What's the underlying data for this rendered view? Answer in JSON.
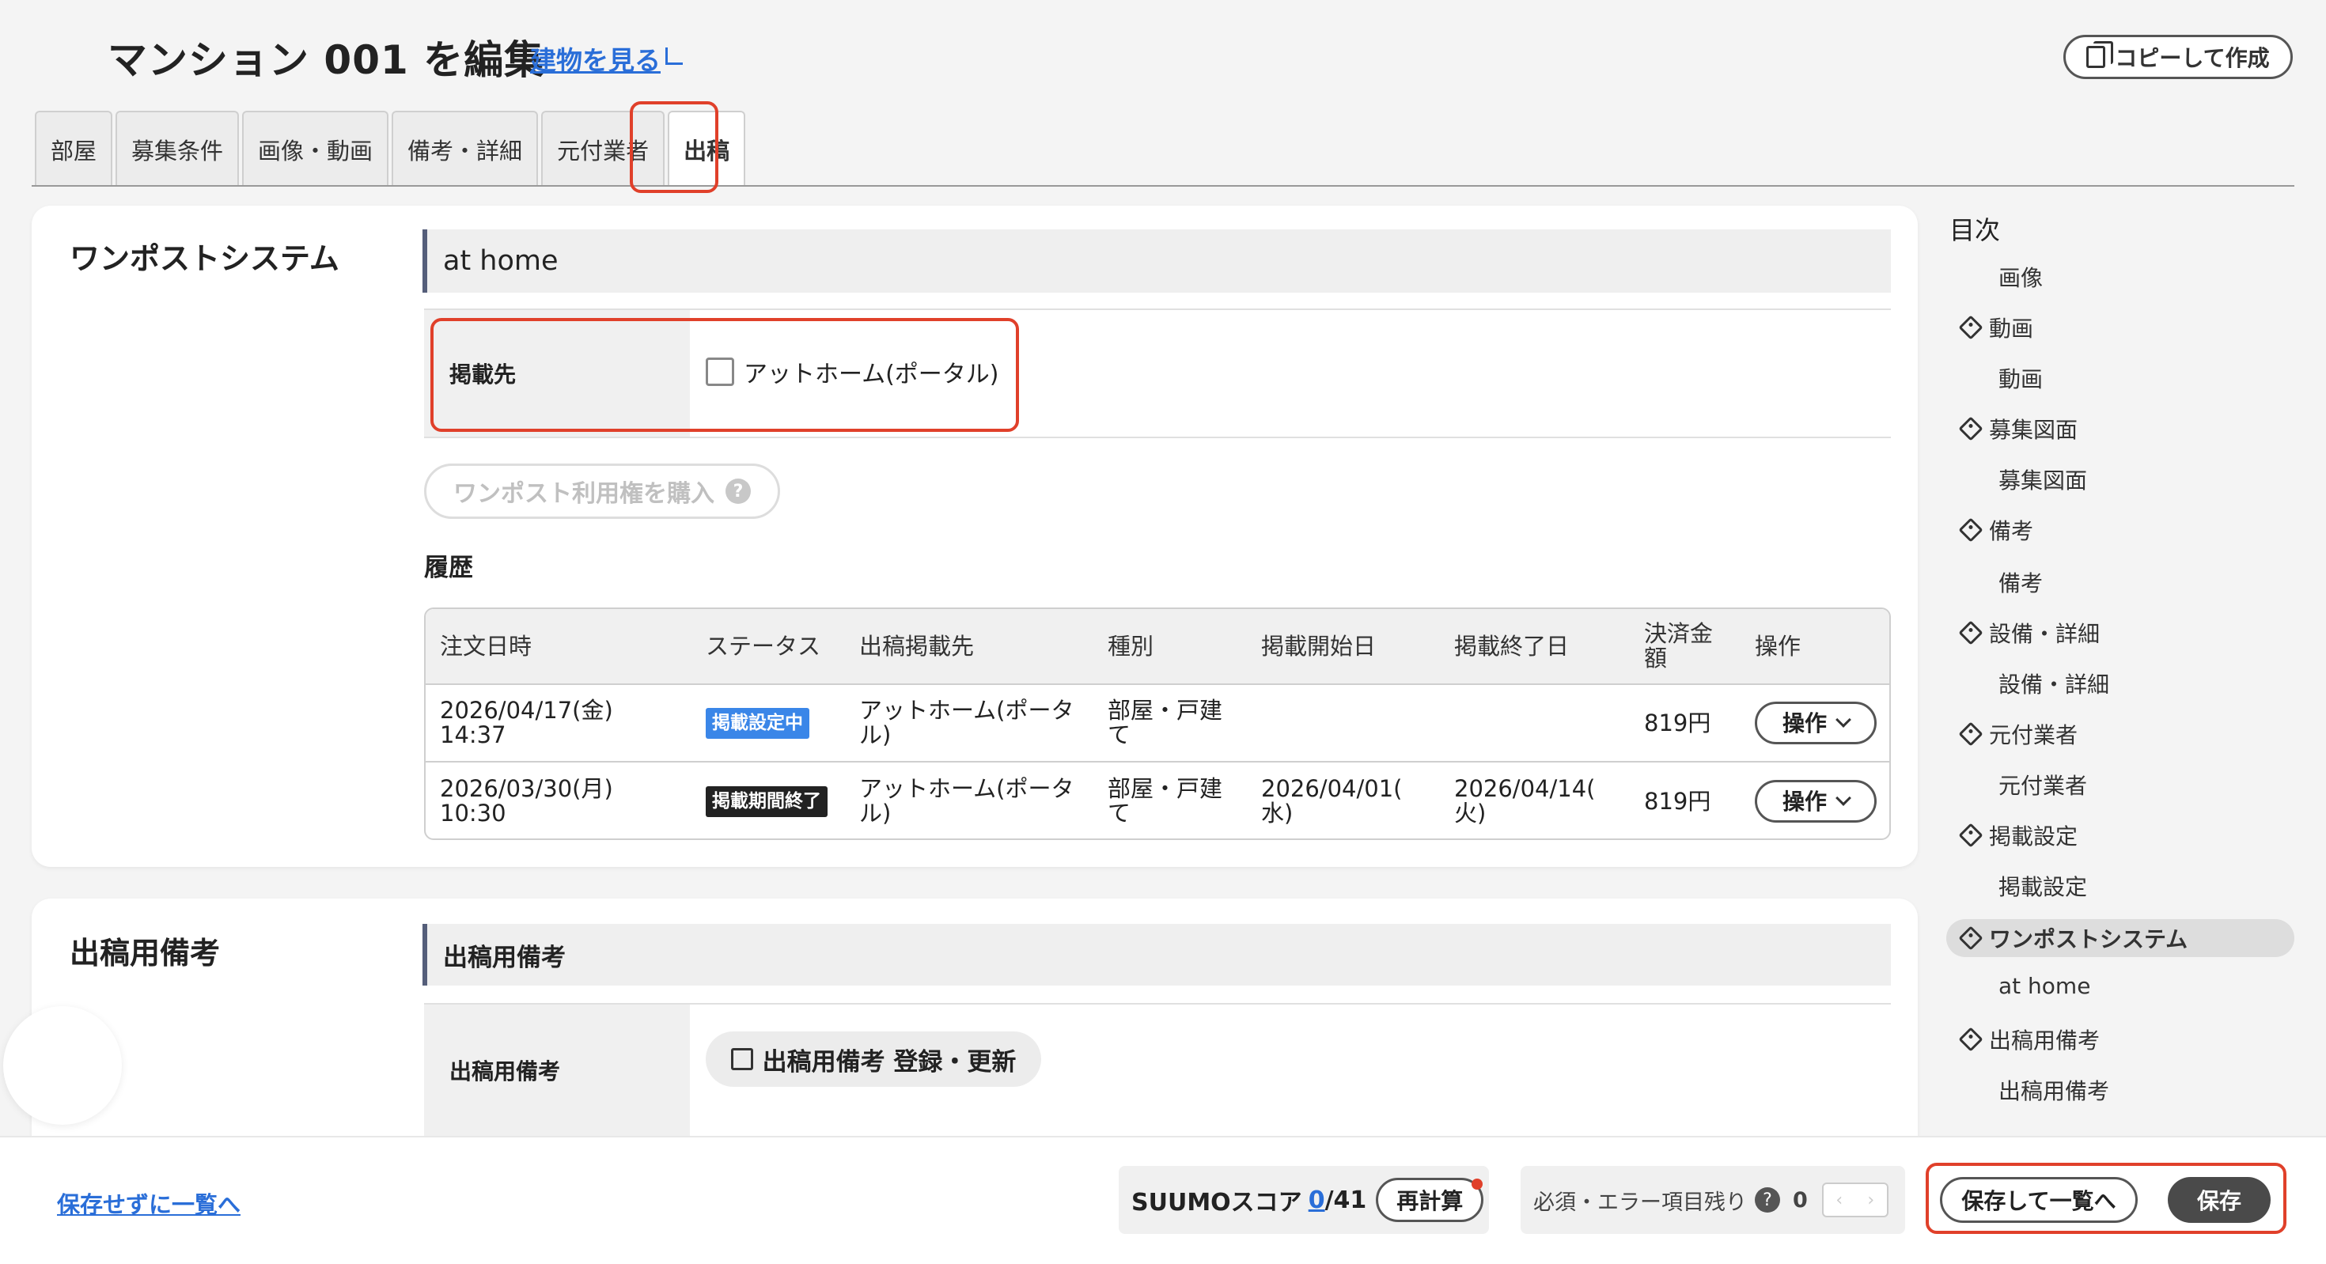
{
  "header": {
    "title": "マンション 001 を編集",
    "view_building": "建物を見る",
    "copy_button": "コピーして作成"
  },
  "tabs": [
    {
      "label": "部屋"
    },
    {
      "label": "募集条件"
    },
    {
      "label": "画像・動画"
    },
    {
      "label": "備考・詳細"
    },
    {
      "label": "元付業者"
    },
    {
      "label": "出稿",
      "active": true
    }
  ],
  "onepost": {
    "section_title": "ワンポストシステム",
    "subhead": "at home",
    "destination_label": "掲載先",
    "destination_option": "アットホーム(ポータル)",
    "destination_checked": false,
    "buy_button": "ワンポスト利用権を購入",
    "history_title": "履歴",
    "table": {
      "headers": [
        "注文日時",
        "ステータス",
        "出稿掲載先",
        "種別",
        "掲載開始日",
        "掲載終了日",
        "決済金額",
        "操作"
      ],
      "headers_line2": [
        "",
        "",
        "",
        "",
        "",
        "",
        "額",
        ""
      ],
      "headers_line1": [
        "注文日時",
        "ステータス",
        "出稿掲載先",
        "種別",
        "掲載開始日",
        "掲載終了日",
        "決済金",
        "操作"
      ],
      "rows": [
        {
          "date1": "2026/04/17(金)",
          "date2": "14:37",
          "status": "掲載設定中",
          "dest1": "アットホーム(ポータ",
          "dest2": "ル)",
          "type1": "部屋・戸建",
          "type2": "て",
          "start1": "",
          "start2": "",
          "end1": "",
          "end2": "",
          "amount": "819円",
          "op": "操作"
        },
        {
          "date1": "2026/03/30(月)",
          "date2": "10:30",
          "status": "掲載期間終了",
          "dest1": "アットホーム(ポータ",
          "dest2": "ル)",
          "type1": "部屋・戸建",
          "type2": "て",
          "start1": "2026/04/01(",
          "start2": "水)",
          "end1": "2026/04/14(",
          "end2": "火)",
          "amount": "819円",
          "op": "操作"
        }
      ]
    }
  },
  "memo": {
    "section_title": "出稿用備考",
    "subhead": "出稿用備考",
    "label": "出稿用備考",
    "button": "出稿用備考 登録・更新"
  },
  "toc": {
    "title": "目次",
    "items": [
      {
        "label": "画像",
        "level": "sub"
      },
      {
        "label": "動画",
        "level": "parent"
      },
      {
        "label": "動画",
        "level": "sub"
      },
      {
        "label": "募集図面",
        "level": "parent"
      },
      {
        "label": "募集図面",
        "level": "sub"
      },
      {
        "label": "備考",
        "level": "parent"
      },
      {
        "label": "備考",
        "level": "sub"
      },
      {
        "label": "設備・詳細",
        "level": "parent"
      },
      {
        "label": "設備・詳細",
        "level": "sub"
      },
      {
        "label": "元付業者",
        "level": "parent"
      },
      {
        "label": "元付業者",
        "level": "sub"
      },
      {
        "label": "掲載設定",
        "level": "parent"
      },
      {
        "label": "掲載設定",
        "level": "sub"
      },
      {
        "label": "ワンポストシステム",
        "level": "parent",
        "active": true
      },
      {
        "label": "at home",
        "level": "sub"
      },
      {
        "label": "出稿用備考",
        "level": "parent"
      },
      {
        "label": "出稿用備考",
        "level": "sub"
      }
    ]
  },
  "footer": {
    "back_link": "保存せずに一覧へ",
    "score_label": "SUUMOスコア",
    "score_value": "0",
    "score_total": "/41",
    "recalc_button": "再計算",
    "required_label": "必須・エラー項目残り",
    "required_count": "0",
    "save_and_list": "保存して一覧へ",
    "save": "保存"
  },
  "colors": {
    "accent_blue": "#2a6ed8",
    "highlight_red": "#e0402a",
    "status_blue": "#3a86e8",
    "status_dark": "#222222"
  }
}
